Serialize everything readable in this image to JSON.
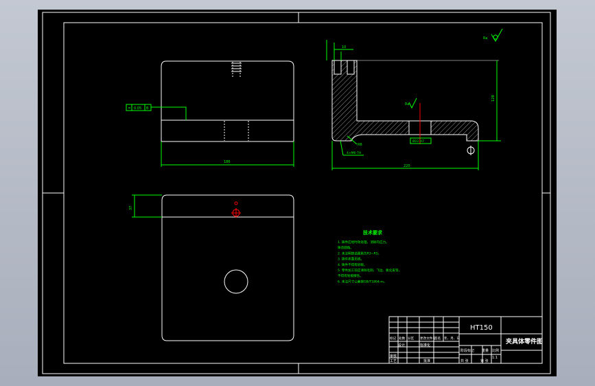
{
  "title_block": {
    "material": "HT150",
    "part_name": "夹具体零件图",
    "col_headers": [
      "标记",
      "处数",
      "分区",
      "更改文件号",
      "签名",
      "年、月、日"
    ],
    "row_design": "设计",
    "row_standard": "标准化",
    "row_review": "审核",
    "row_process": "工艺",
    "row_approve": "批准",
    "stage_mark": "阶段标记",
    "weight": "重量",
    "scale": "比例",
    "scale_value": "1:1",
    "sheet_total": "共 张",
    "sheet_num": "第 张"
  },
  "tech_req": {
    "title": "技术要求",
    "lines": [
      "1. 铸件应经时效处理，消除内应力。",
      "   铸造圆角。",
      "2. 未注明铸造圆角为R3~R5。",
      "3. 铸件表面无锐。",
      "4. 铸件不得有砂眼。",
      "5. 零件加工前应清除毛刺、飞边、氧化皮等，",
      "   不得有划痕擦伤。",
      "6. 未注尺寸公差按GB/T1804-m。"
    ]
  },
  "annotations": {
    "front_width": "186",
    "flatness": "0.05",
    "flatness_datum": "B",
    "side_width": "220",
    "side_height": "128",
    "hole_tol": "Ø22 H7",
    "roughness": "Ra",
    "bolt": "M8",
    "radius": "R6",
    "plan_offset": "37",
    "side_dim_top": "10",
    "side_dim_note": "4×M6-7H"
  }
}
